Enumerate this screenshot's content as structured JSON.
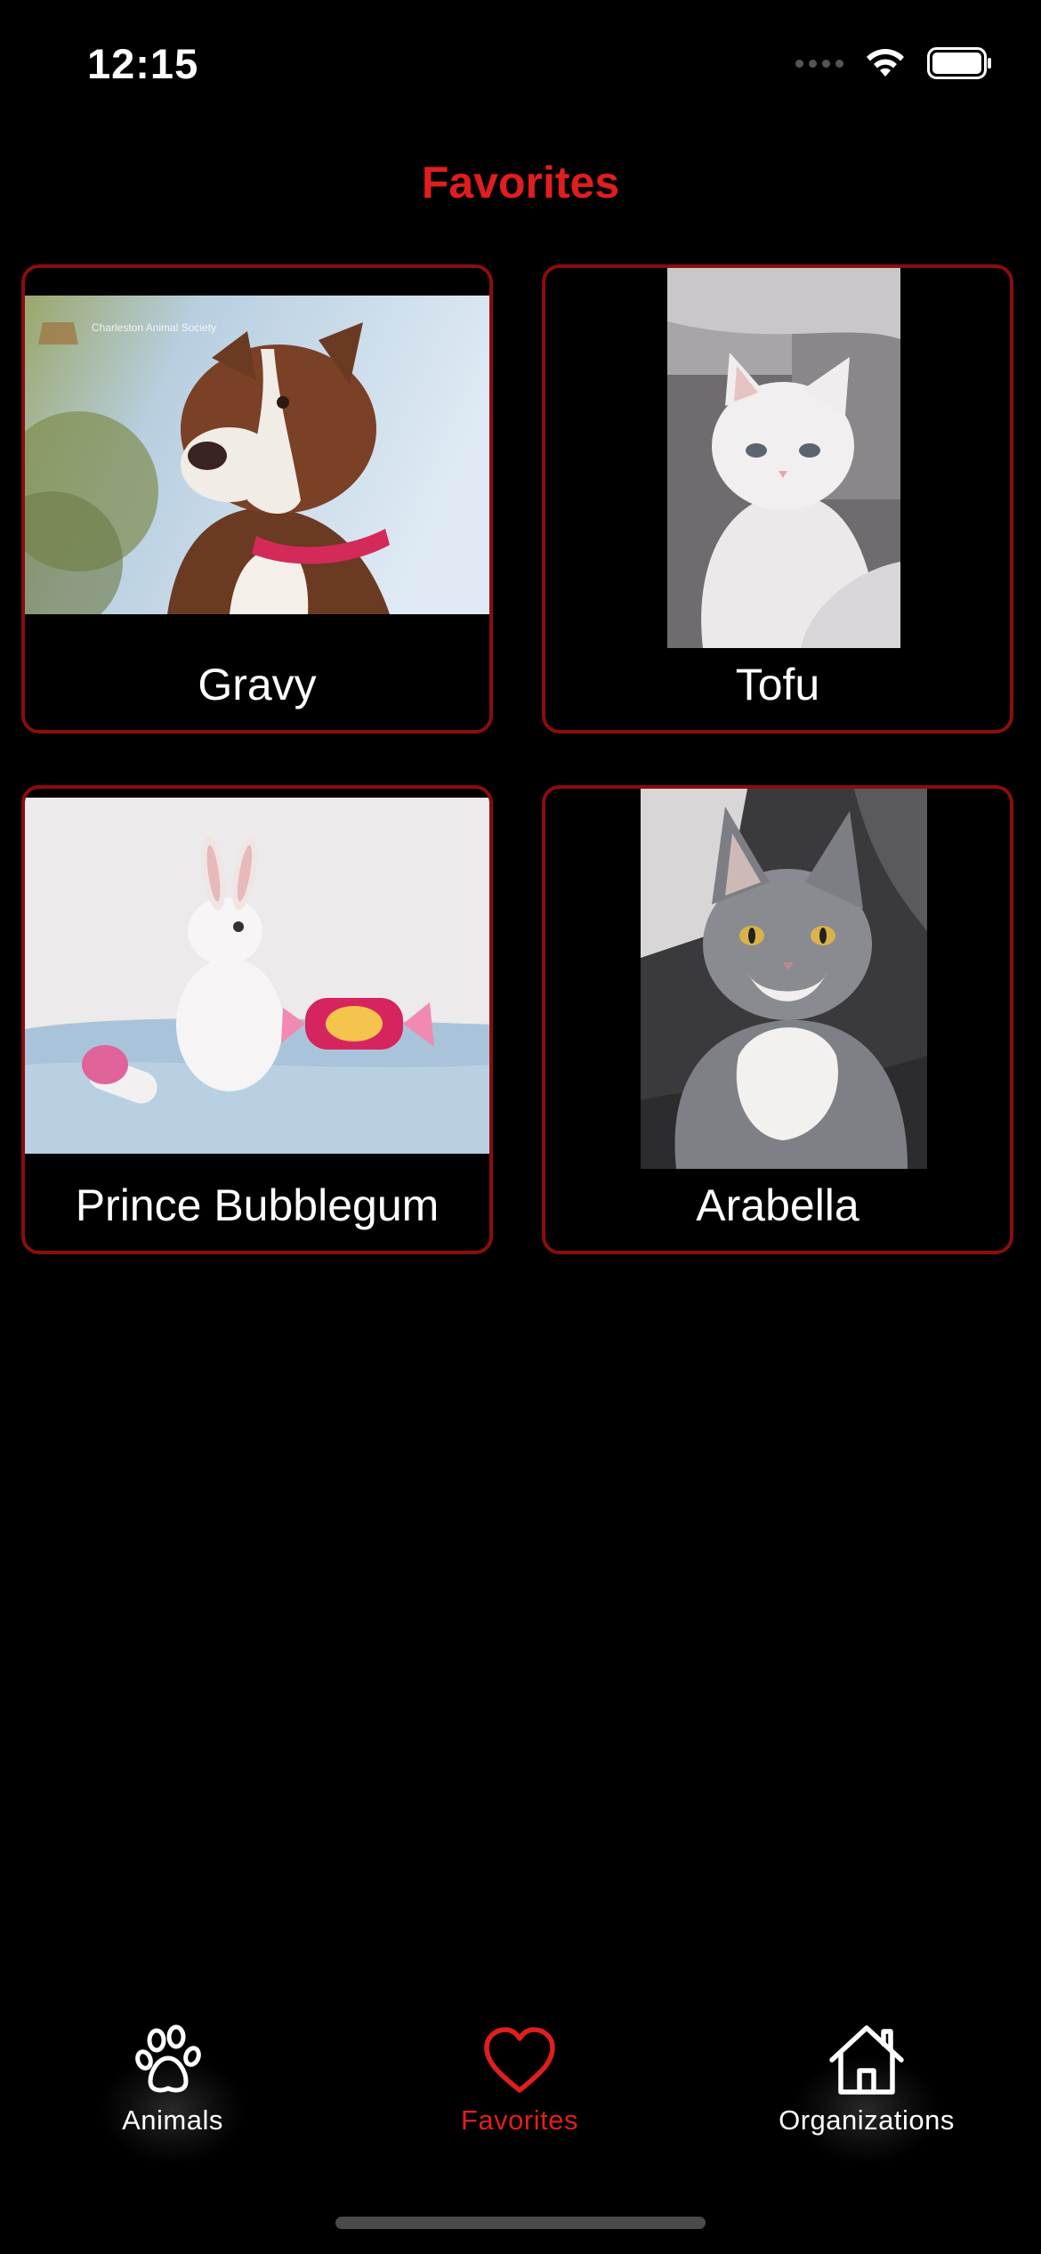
{
  "status_bar": {
    "time": "12:15"
  },
  "header": {
    "title": "Favorites"
  },
  "favorites": [
    {
      "name": "Gravy",
      "photo": "brown and white pit bull dog with pink collar",
      "photo_watermark": "Charleston Animal Society"
    },
    {
      "name": "Tofu",
      "photo": "white cat"
    },
    {
      "name": "Prince Bubblegum",
      "photo": "white rabbit with pink candy toys"
    },
    {
      "name": "Arabella",
      "photo": "grey and white cat"
    }
  ],
  "tab_bar": {
    "tabs": [
      {
        "label": "Animals",
        "icon": "paw-icon",
        "active": false
      },
      {
        "label": "Favorites",
        "icon": "heart-icon",
        "active": true
      },
      {
        "label": "Organizations",
        "icon": "house-icon",
        "active": false
      }
    ]
  },
  "colors": {
    "accent": "#e01e1e",
    "card_border": "#8b0d0d",
    "background": "#000000",
    "tab_inactive": "#ffffff"
  }
}
